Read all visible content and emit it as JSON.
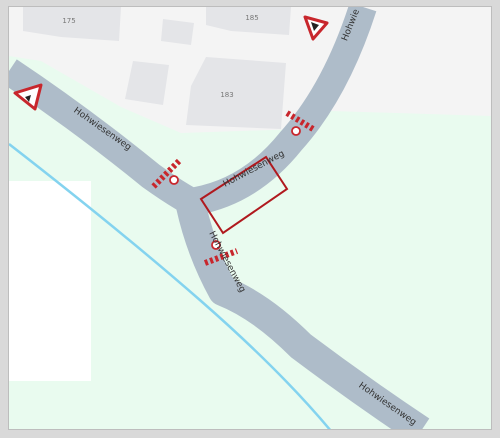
{
  "map": {
    "street_labels": {
      "upper_left": "Hohwiesenweg",
      "center_box": "Hohwiesenweg",
      "center_vertical": "Hohwiesenweg",
      "lower_right": "Hohwiesenweg",
      "top_right": "Hohwie"
    },
    "house_numbers": {
      "h175": "175",
      "h185": "185",
      "h183": "183"
    },
    "colors": {
      "road": "#aebcc9",
      "greenery": "#e6f9ee",
      "building_area": "#f3f3f3",
      "building": "#e3e3e5",
      "water": "#7fd3f0",
      "selection": "#b0191e",
      "marker": "#c8262c"
    },
    "icons": [
      "warning-sign-icon",
      "crossing-marker-icon",
      "selection-rectangle"
    ]
  }
}
